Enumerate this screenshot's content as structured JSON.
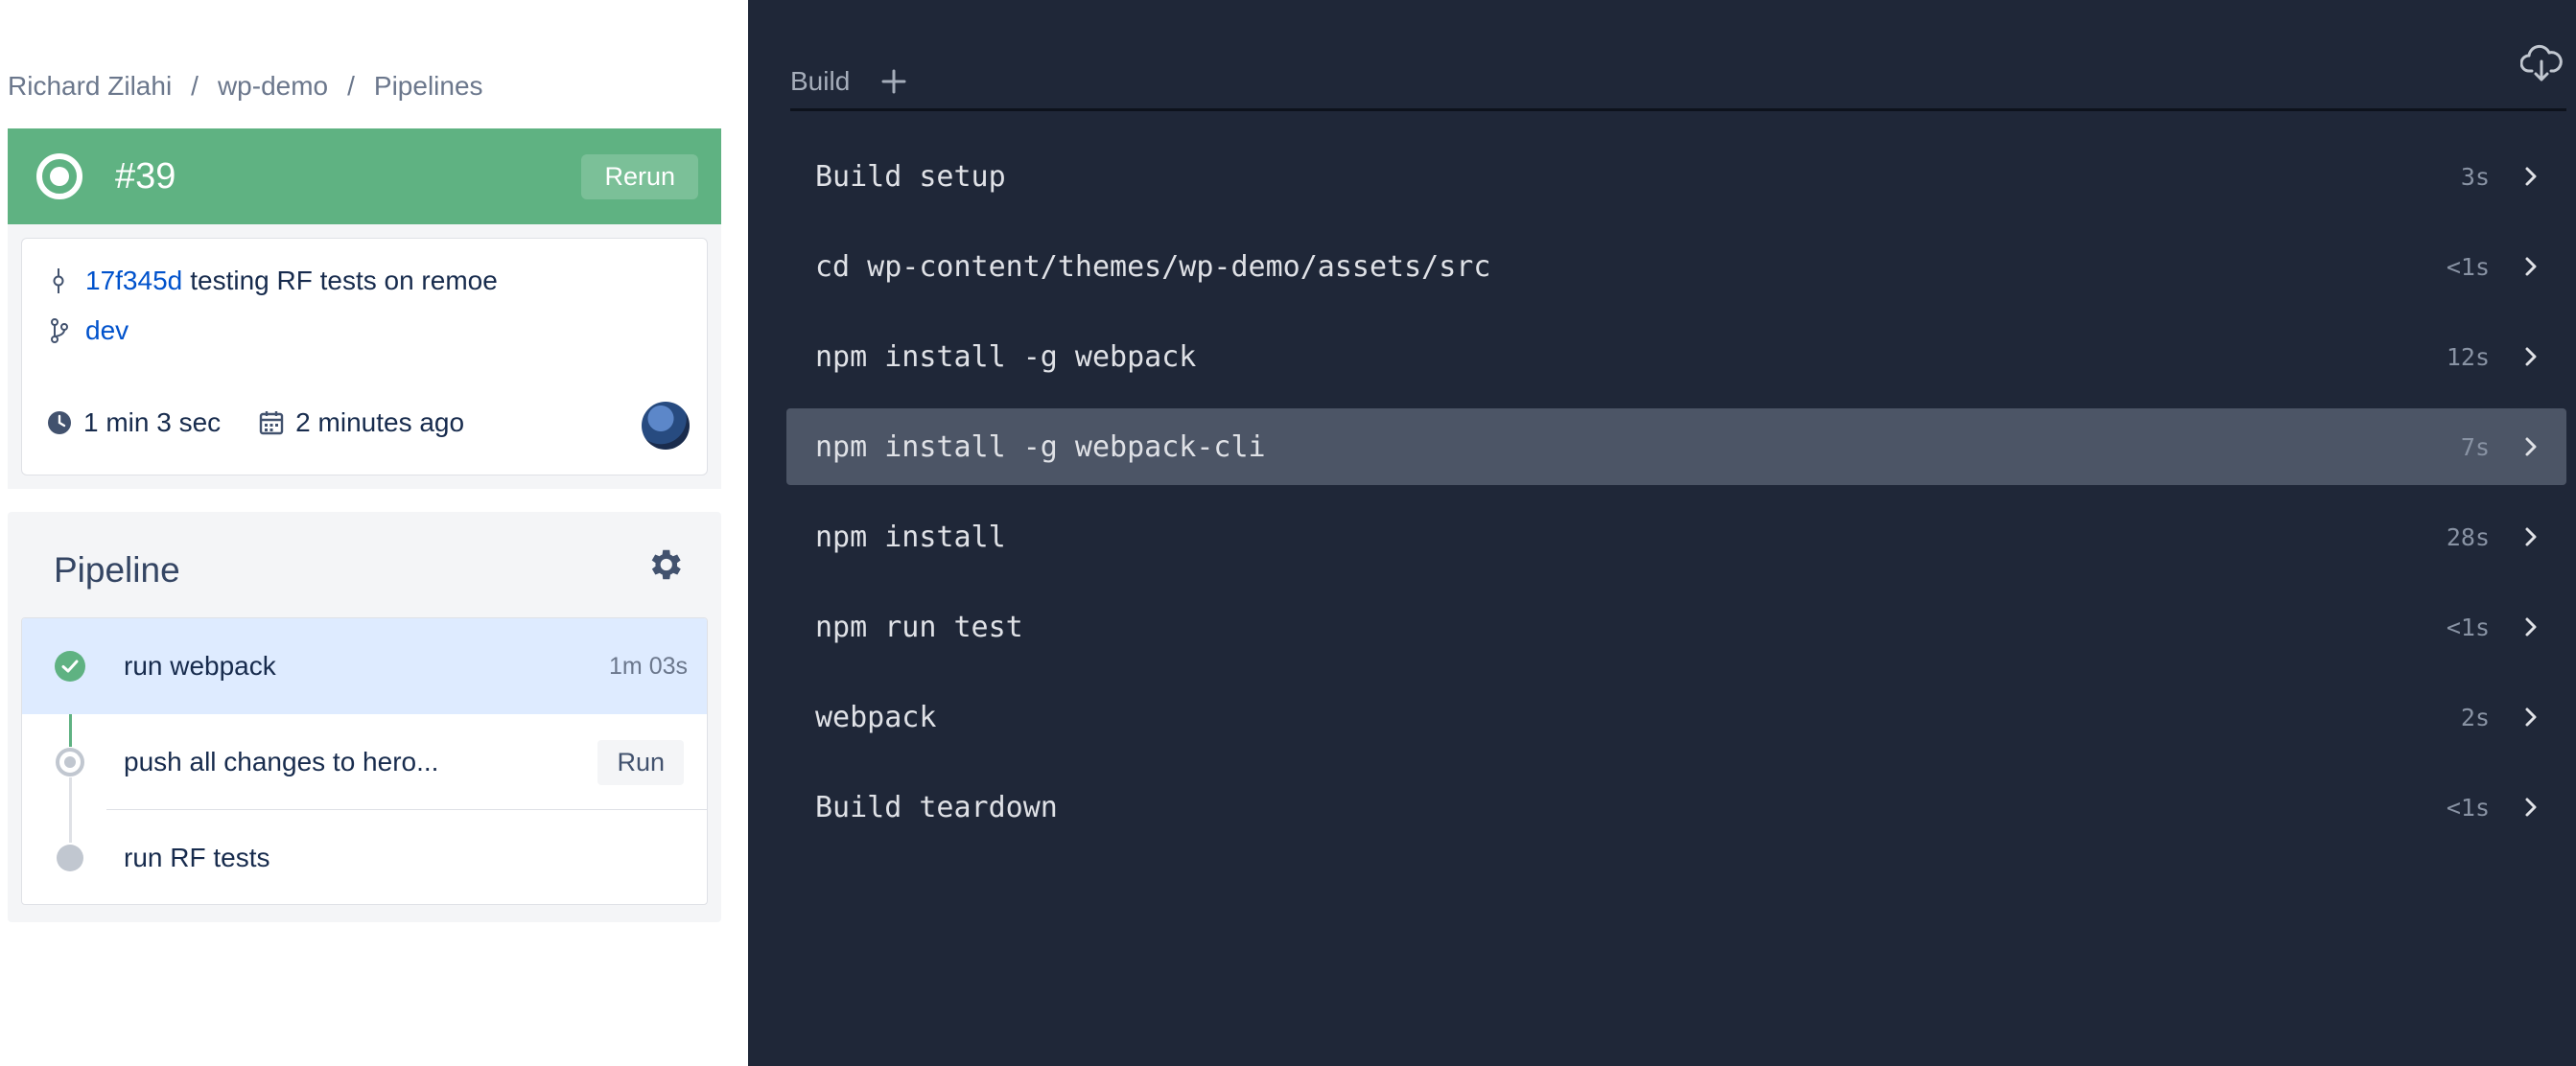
{
  "breadcrumb": {
    "owner": "Richard Zilahi",
    "separator": "/",
    "repo": "wp-demo",
    "section": "Pipelines"
  },
  "build": {
    "number": "#39",
    "status": "success",
    "status_color": "#5fb282",
    "rerun_label": "Rerun"
  },
  "commit": {
    "hash": "17f345d",
    "message": "testing RF tests on remoe",
    "branch": "dev",
    "duration": "1 min 3 sec",
    "created": "2 minutes ago"
  },
  "pipeline": {
    "title": "Pipeline",
    "steps": [
      {
        "label": "run webpack",
        "time": "1m 03s",
        "status": "success"
      },
      {
        "label": "push all changes to hero...",
        "action_label": "Run",
        "status": "manual"
      },
      {
        "label": "run RF tests",
        "status": "pending"
      }
    ]
  },
  "log": {
    "tab_label": "Build",
    "commands": [
      {
        "name": "Build setup",
        "duration": "3s"
      },
      {
        "name": "cd wp-content/themes/wp-demo/assets/src",
        "duration": "<1s"
      },
      {
        "name": "npm install -g webpack",
        "duration": "12s"
      },
      {
        "name": "npm install -g webpack-cli",
        "duration": "7s",
        "highlighted": true
      },
      {
        "name": "npm install",
        "duration": "28s"
      },
      {
        "name": "npm run test",
        "duration": "<1s"
      },
      {
        "name": "webpack",
        "duration": "2s"
      },
      {
        "name": "Build teardown",
        "duration": "<1s"
      }
    ]
  },
  "colors": {
    "panel_dark": "#1f2738",
    "success": "#5fb282",
    "link": "#0052cc",
    "active_step_bg": "#deebff",
    "highlight_row": "#4c5566"
  }
}
